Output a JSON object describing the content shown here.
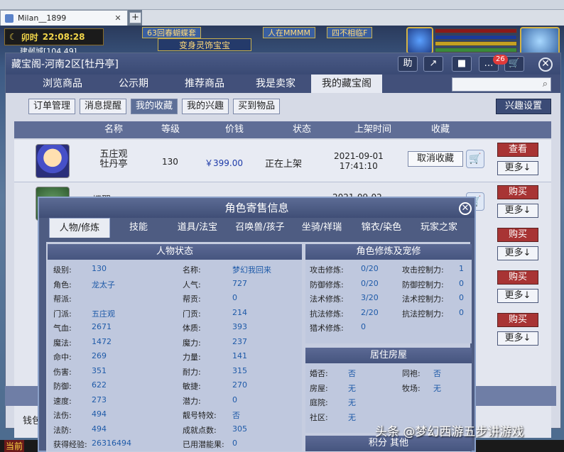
{
  "browser": {
    "tab_title": "Milan__1899",
    "tab_close": "✕",
    "tab_add": "+"
  },
  "hud": {
    "time_label": "卯时",
    "clock": "22:08:28",
    "location": "建邺城[104,49]"
  },
  "banners": {
    "top1": "63回春蝴蝶套",
    "top2": "人在MMMM",
    "top3": "四不相临F",
    "mid": "变身灵饰宝宝"
  },
  "window": {
    "title": "藏宝阁-河南2区[牡丹亭]",
    "icons": [
      {
        "name": "assistant-icon",
        "glyph": "助"
      },
      {
        "name": "share-icon",
        "glyph": "↗"
      },
      {
        "name": "stop-icon",
        "glyph": "■"
      },
      {
        "name": "chat-icon",
        "glyph": "…"
      },
      {
        "name": "cart-icon",
        "glyph": "🛒"
      }
    ],
    "badge": "26",
    "close": "✕"
  },
  "nav": {
    "items": [
      "浏览商品",
      "公示期",
      "推荐商品",
      "我是卖家",
      "我的藏宝阁"
    ],
    "active": 4,
    "search_icon": "⌕"
  },
  "subnav": {
    "items": [
      "订单管理",
      "消息提醒",
      "我的收藏",
      "我的兴趣",
      "买到物品"
    ],
    "active": 2,
    "interest_settings": "兴趣设置"
  },
  "table": {
    "headers": [
      "名称",
      "等级",
      "价钱",
      "状态",
      "上架时间",
      "收藏"
    ],
    "row": {
      "name_line1": "五庄观",
      "name_line2": "牡丹亭",
      "level": "130",
      "price": "￥399.00",
      "status": "正在上架",
      "date": "2021-09-01",
      "time": "17:41:10",
      "unfav": "取消收藏",
      "view": "查看",
      "more": "更多↓"
    },
    "partial_name": "蝶翼",
    "partial_date": "2021-09-02",
    "buy": "购买",
    "more": "更多↓"
  },
  "footer": {
    "left_text": "钱包",
    "now": "当前"
  },
  "popup": {
    "title": "角色寄售信息",
    "close": "✕",
    "tabs": [
      "人物/修炼",
      "技能",
      "道具/法宝",
      "召唤兽/孩子",
      "坐骑/祥瑞",
      "锦衣/染色",
      "玩家之家"
    ],
    "active_tab": 0,
    "left_section": "人物状态",
    "left_col1": [
      [
        "级别:",
        "130"
      ],
      [
        "角色:",
        "龙太子"
      ],
      [
        "帮派:",
        ""
      ],
      [
        "门派:",
        "五庄观"
      ],
      [
        "气血:",
        "2671"
      ],
      [
        "魔法:",
        "1472"
      ],
      [
        "命中:",
        "269"
      ],
      [
        "伤害:",
        "351"
      ],
      [
        "防御:",
        "622"
      ],
      [
        "速度:",
        "273"
      ],
      [
        "法伤:",
        "494"
      ],
      [
        "法防:",
        "494"
      ],
      [
        "获得经验:",
        "26316494"
      ]
    ],
    "left_col2": [
      [
        "名称:",
        "梦幻我回来"
      ],
      [
        "人气:",
        "727"
      ],
      [
        "帮贡:",
        "0"
      ],
      [
        "门贡:",
        "214"
      ],
      [
        "体质:",
        "393"
      ],
      [
        "魔力:",
        "237"
      ],
      [
        "力量:",
        "141"
      ],
      [
        "耐力:",
        "315"
      ],
      [
        "敏捷:",
        "270"
      ],
      [
        "潜力:",
        "0"
      ],
      [
        "靓号特效:",
        "否"
      ],
      [
        "成就点数:",
        "305"
      ],
      [
        "已用潜能果:",
        "0"
      ]
    ],
    "right_section1": "角色修炼及宠修",
    "cultivation_col1": [
      [
        "攻击修炼:",
        "0/20"
      ],
      [
        "防御修炼:",
        "0/20"
      ],
      [
        "法术修炼:",
        "3/20"
      ],
      [
        "抗法修炼:",
        "2/20"
      ],
      [
        "猎术修炼:",
        "0"
      ]
    ],
    "cultivation_col2": [
      [
        "攻击控制力:",
        "1"
      ],
      [
        "防御控制力:",
        "0"
      ],
      [
        "法术控制力:",
        "0"
      ],
      [
        "抗法控制力:",
        "0"
      ]
    ],
    "right_section2": "居住房屋",
    "house_col1": [
      [
        "婚否:",
        "否"
      ],
      [
        "房屋:",
        "无"
      ],
      [
        "庭院:",
        "无"
      ],
      [
        "社区:",
        "无"
      ]
    ],
    "house_col2": [
      [
        "同袍:",
        "否"
      ],
      [
        "牧场:",
        "无"
      ]
    ],
    "right_section3": "积分 其他"
  },
  "watermark": "头条 @梦幻西游五步讲游戏"
}
